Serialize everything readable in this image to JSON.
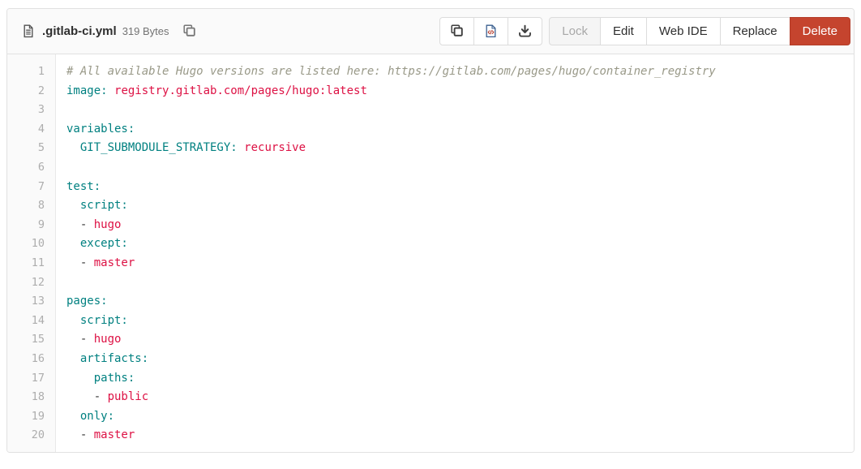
{
  "header": {
    "file_name": ".gitlab-ci.yml",
    "file_size": "319 Bytes",
    "icon_buttons": [
      {
        "name": "copy-contents-button",
        "icon": "copy-icon"
      },
      {
        "name": "open-raw-button",
        "icon": "raw-file-icon"
      },
      {
        "name": "download-button",
        "icon": "download-icon"
      }
    ],
    "actions": {
      "lock_label": "Lock",
      "edit_label": "Edit",
      "web_ide_label": "Web IDE",
      "replace_label": "Replace",
      "delete_label": "Delete"
    }
  },
  "colors": {
    "header_bg": "#fafafa",
    "border": "#e1e1e1",
    "delete_button_bg": "#c5442e",
    "syntax_key": "#008080",
    "syntax_value": "#dd1144",
    "syntax_comment": "#999988",
    "line_number": "#adadad"
  },
  "code": {
    "language": "yaml",
    "lines": [
      {
        "n": 1,
        "segs": [
          [
            "com",
            "# All available Hugo versions are listed here: https://gitlab.com/pages/hugo/container_registry"
          ]
        ]
      },
      {
        "n": 2,
        "segs": [
          [
            "key",
            "image:"
          ],
          [
            "pln",
            " "
          ],
          [
            "val",
            "registry.gitlab.com/pages/hugo:latest"
          ]
        ]
      },
      {
        "n": 3,
        "segs": []
      },
      {
        "n": 4,
        "segs": [
          [
            "key",
            "variables:"
          ]
        ]
      },
      {
        "n": 5,
        "segs": [
          [
            "pln",
            "  "
          ],
          [
            "key",
            "GIT_SUBMODULE_STRATEGY:"
          ],
          [
            "pln",
            " "
          ],
          [
            "val",
            "recursive"
          ]
        ]
      },
      {
        "n": 6,
        "segs": []
      },
      {
        "n": 7,
        "segs": [
          [
            "key",
            "test:"
          ]
        ]
      },
      {
        "n": 8,
        "segs": [
          [
            "pln",
            "  "
          ],
          [
            "key",
            "script:"
          ]
        ]
      },
      {
        "n": 9,
        "segs": [
          [
            "pln",
            "  - "
          ],
          [
            "val",
            "hugo"
          ]
        ]
      },
      {
        "n": 10,
        "segs": [
          [
            "pln",
            "  "
          ],
          [
            "key",
            "except:"
          ]
        ]
      },
      {
        "n": 11,
        "segs": [
          [
            "pln",
            "  - "
          ],
          [
            "val",
            "master"
          ]
        ]
      },
      {
        "n": 12,
        "segs": []
      },
      {
        "n": 13,
        "segs": [
          [
            "key",
            "pages:"
          ]
        ]
      },
      {
        "n": 14,
        "segs": [
          [
            "pln",
            "  "
          ],
          [
            "key",
            "script:"
          ]
        ]
      },
      {
        "n": 15,
        "segs": [
          [
            "pln",
            "  - "
          ],
          [
            "val",
            "hugo"
          ]
        ]
      },
      {
        "n": 16,
        "segs": [
          [
            "pln",
            "  "
          ],
          [
            "key",
            "artifacts:"
          ]
        ]
      },
      {
        "n": 17,
        "segs": [
          [
            "pln",
            "    "
          ],
          [
            "key",
            "paths:"
          ]
        ]
      },
      {
        "n": 18,
        "segs": [
          [
            "pln",
            "    - "
          ],
          [
            "val",
            "public"
          ]
        ]
      },
      {
        "n": 19,
        "segs": [
          [
            "pln",
            "  "
          ],
          [
            "key",
            "only:"
          ]
        ]
      },
      {
        "n": 20,
        "segs": [
          [
            "pln",
            "  - "
          ],
          [
            "val",
            "master"
          ]
        ]
      }
    ]
  }
}
